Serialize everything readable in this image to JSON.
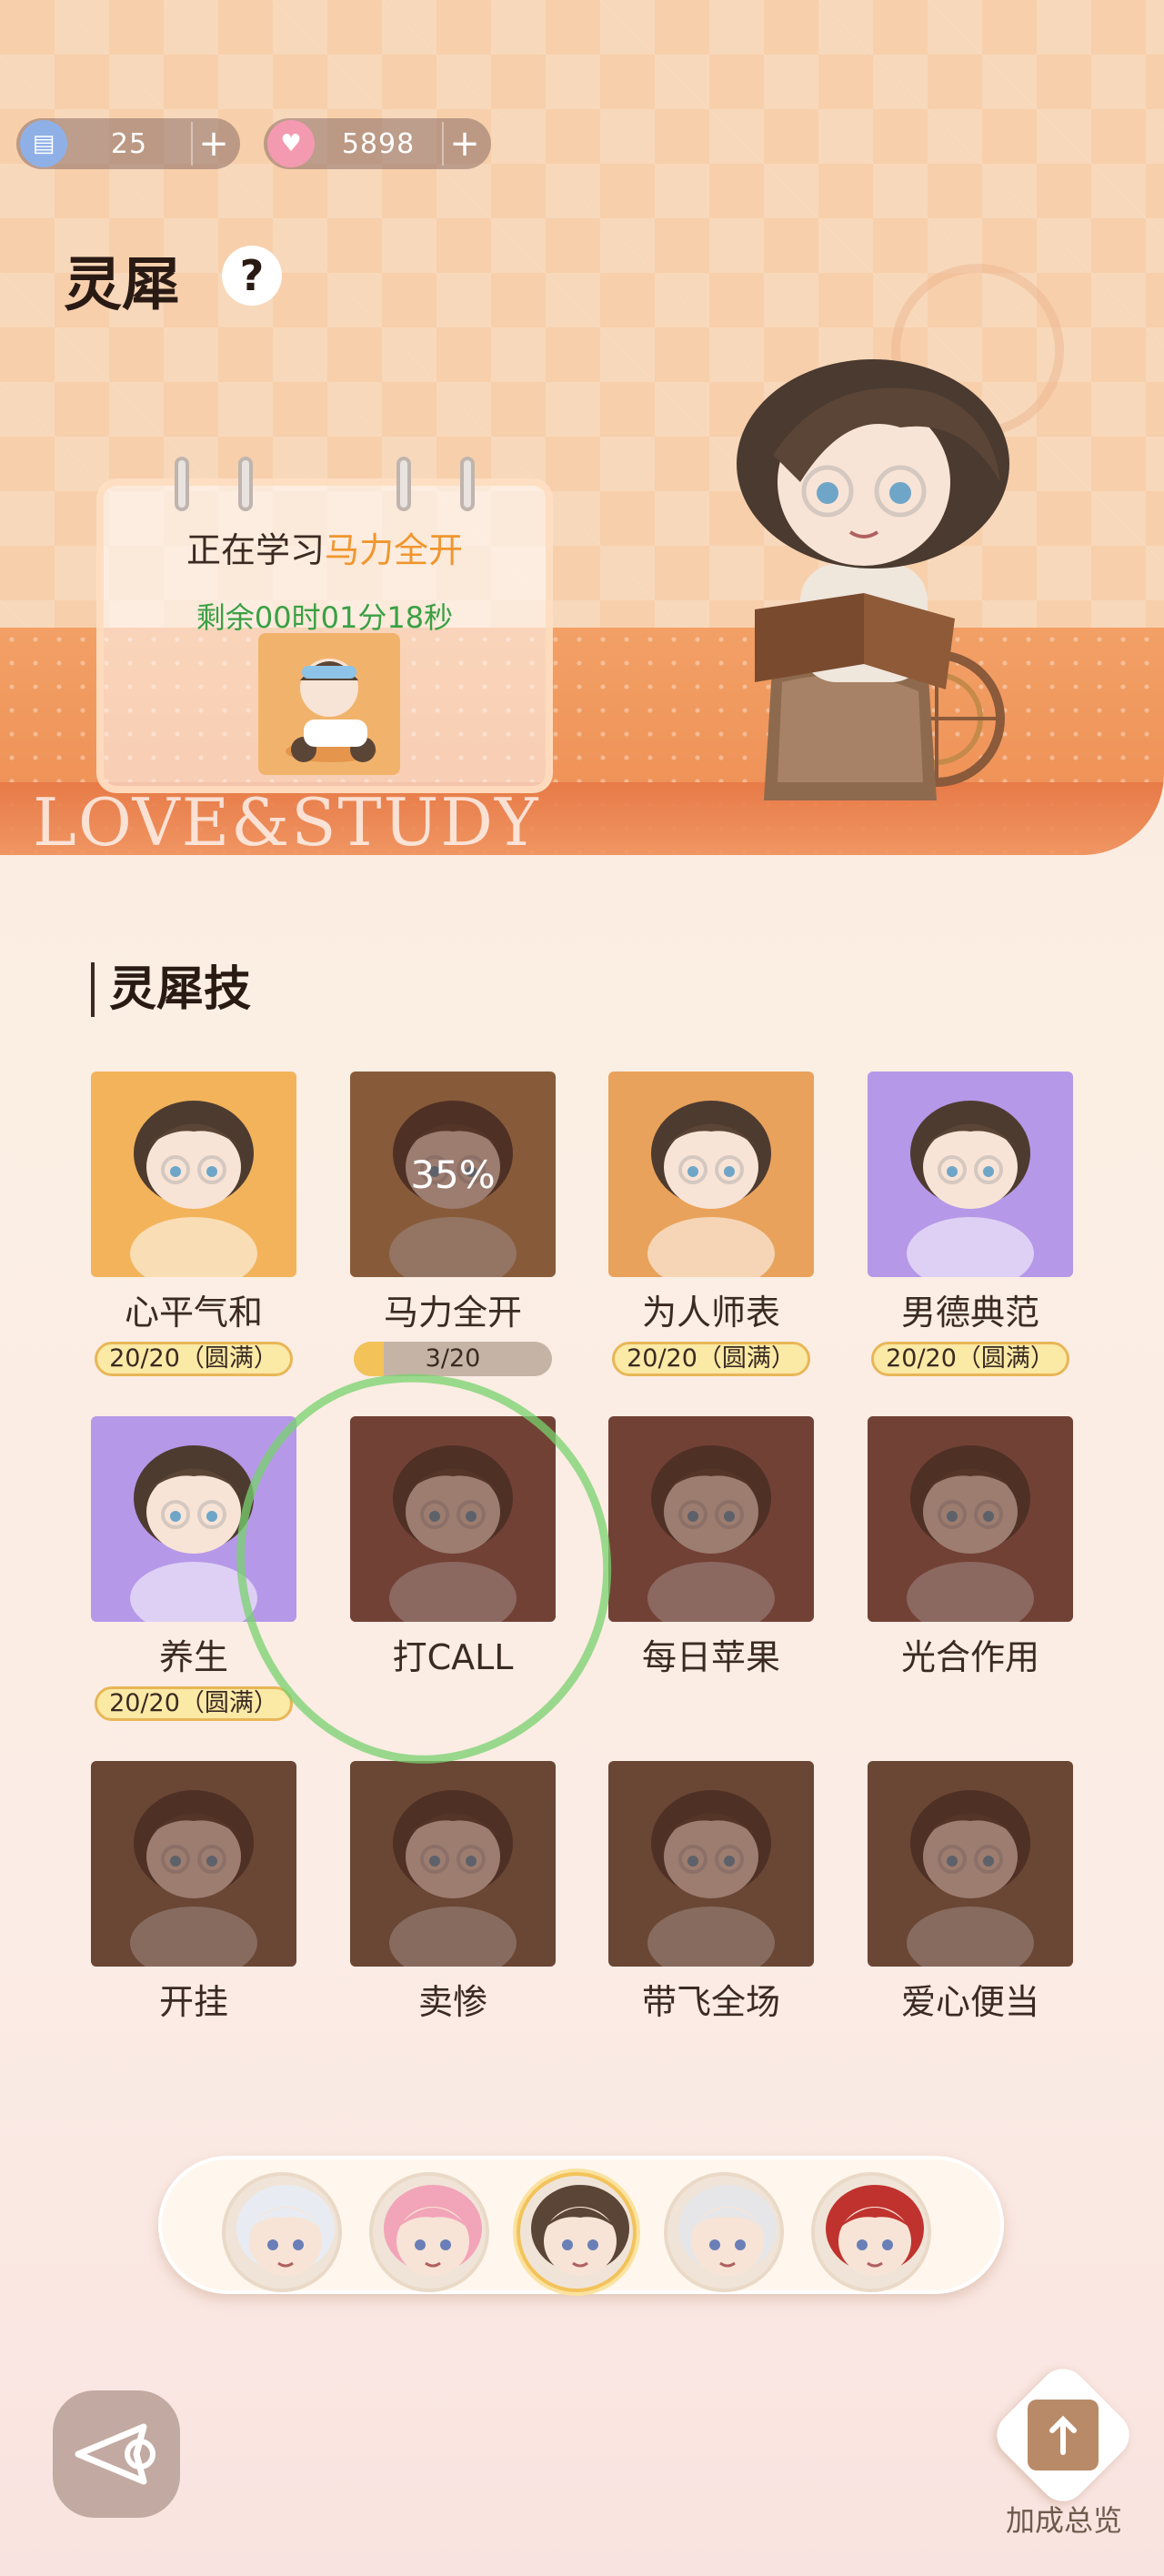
{
  "currency": {
    "tickets": {
      "icon": "ticket-icon",
      "value": "25"
    },
    "hearts": {
      "icon": "heart-coin-icon",
      "value": "5898"
    },
    "plus_label": "+"
  },
  "title": "灵犀",
  "help_label": "?",
  "study": {
    "prefix": "正在学习",
    "skill": "马力全开",
    "remaining": "剩余00时01分18秒"
  },
  "banner_text": "LOVE&STUDY",
  "skills_section_title": "灵犀技",
  "skills": [
    {
      "name": "心平气和",
      "status": "20/20（圆满）",
      "bg": "#f2b35a",
      "locked": false
    },
    {
      "name": "马力全开",
      "progress_label": "3/20",
      "progress": 0.15,
      "pct_label": "35%",
      "bg": "#c99a5b",
      "locked": false
    },
    {
      "name": "为人师表",
      "status": "20/20（圆满）",
      "bg": "#e9a25b",
      "locked": false
    },
    {
      "name": "男德典范",
      "status": "20/20（圆满）",
      "bg": "#b598e8",
      "locked": false
    },
    {
      "name": "养生",
      "status": "20/20（圆满）",
      "bg": "#b598e8",
      "locked": false
    },
    {
      "name": "打CALL",
      "bg": "#9c5f55",
      "locked": true
    },
    {
      "name": "每日苹果",
      "bg": "#9c5f55",
      "locked": true
    },
    {
      "name": "光合作用",
      "bg": "#9c5f55",
      "locked": true
    },
    {
      "name": "开挂",
      "bg": "#8a6a50",
      "locked": true
    },
    {
      "name": "卖惨",
      "bg": "#8a6a50",
      "locked": true
    },
    {
      "name": "带飞全场",
      "bg": "#8a6a50",
      "locked": true
    },
    {
      "name": "爱心便当",
      "bg": "#8a6a50",
      "locked": true
    }
  ],
  "characters": [
    {
      "name": "character-1",
      "hair": "#e8ecf2"
    },
    {
      "name": "character-2",
      "hair": "#f2a4b8"
    },
    {
      "name": "character-3",
      "hair": "#5b4536",
      "active": true
    },
    {
      "name": "character-4",
      "hair": "#e6e6e8"
    },
    {
      "name": "character-5",
      "hair": "#c0322e"
    }
  ],
  "overview_label": "加成总览",
  "colors": {
    "accent": "#f0962e",
    "remaining_green": "#3aa044",
    "badge_fill": "#fbe9a6",
    "highlight_circle": "#78d26e"
  }
}
